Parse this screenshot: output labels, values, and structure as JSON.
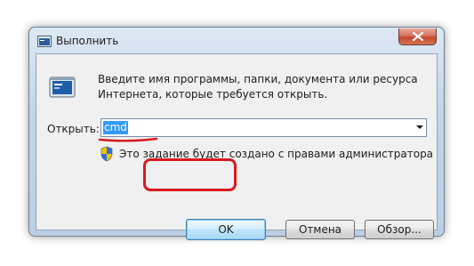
{
  "window": {
    "title": "Выполнить",
    "icon": "run-icon"
  },
  "dialog": {
    "description": "Введите имя программы, папки, документа или ресурса Интернета, которые требуется открыть.",
    "open_label": "Открыть:",
    "open_value": "cmd",
    "admin_note": "Это задание будет создано с правами администратора"
  },
  "buttons": {
    "ok": "OK",
    "cancel": "Отмена",
    "browse": "Обзор..."
  },
  "icons": {
    "close": "close-icon",
    "shield": "shield-icon",
    "dropdown": "chevron-down-icon"
  },
  "colors": {
    "highlight": "#d8191e",
    "selection": "#3399ff"
  }
}
